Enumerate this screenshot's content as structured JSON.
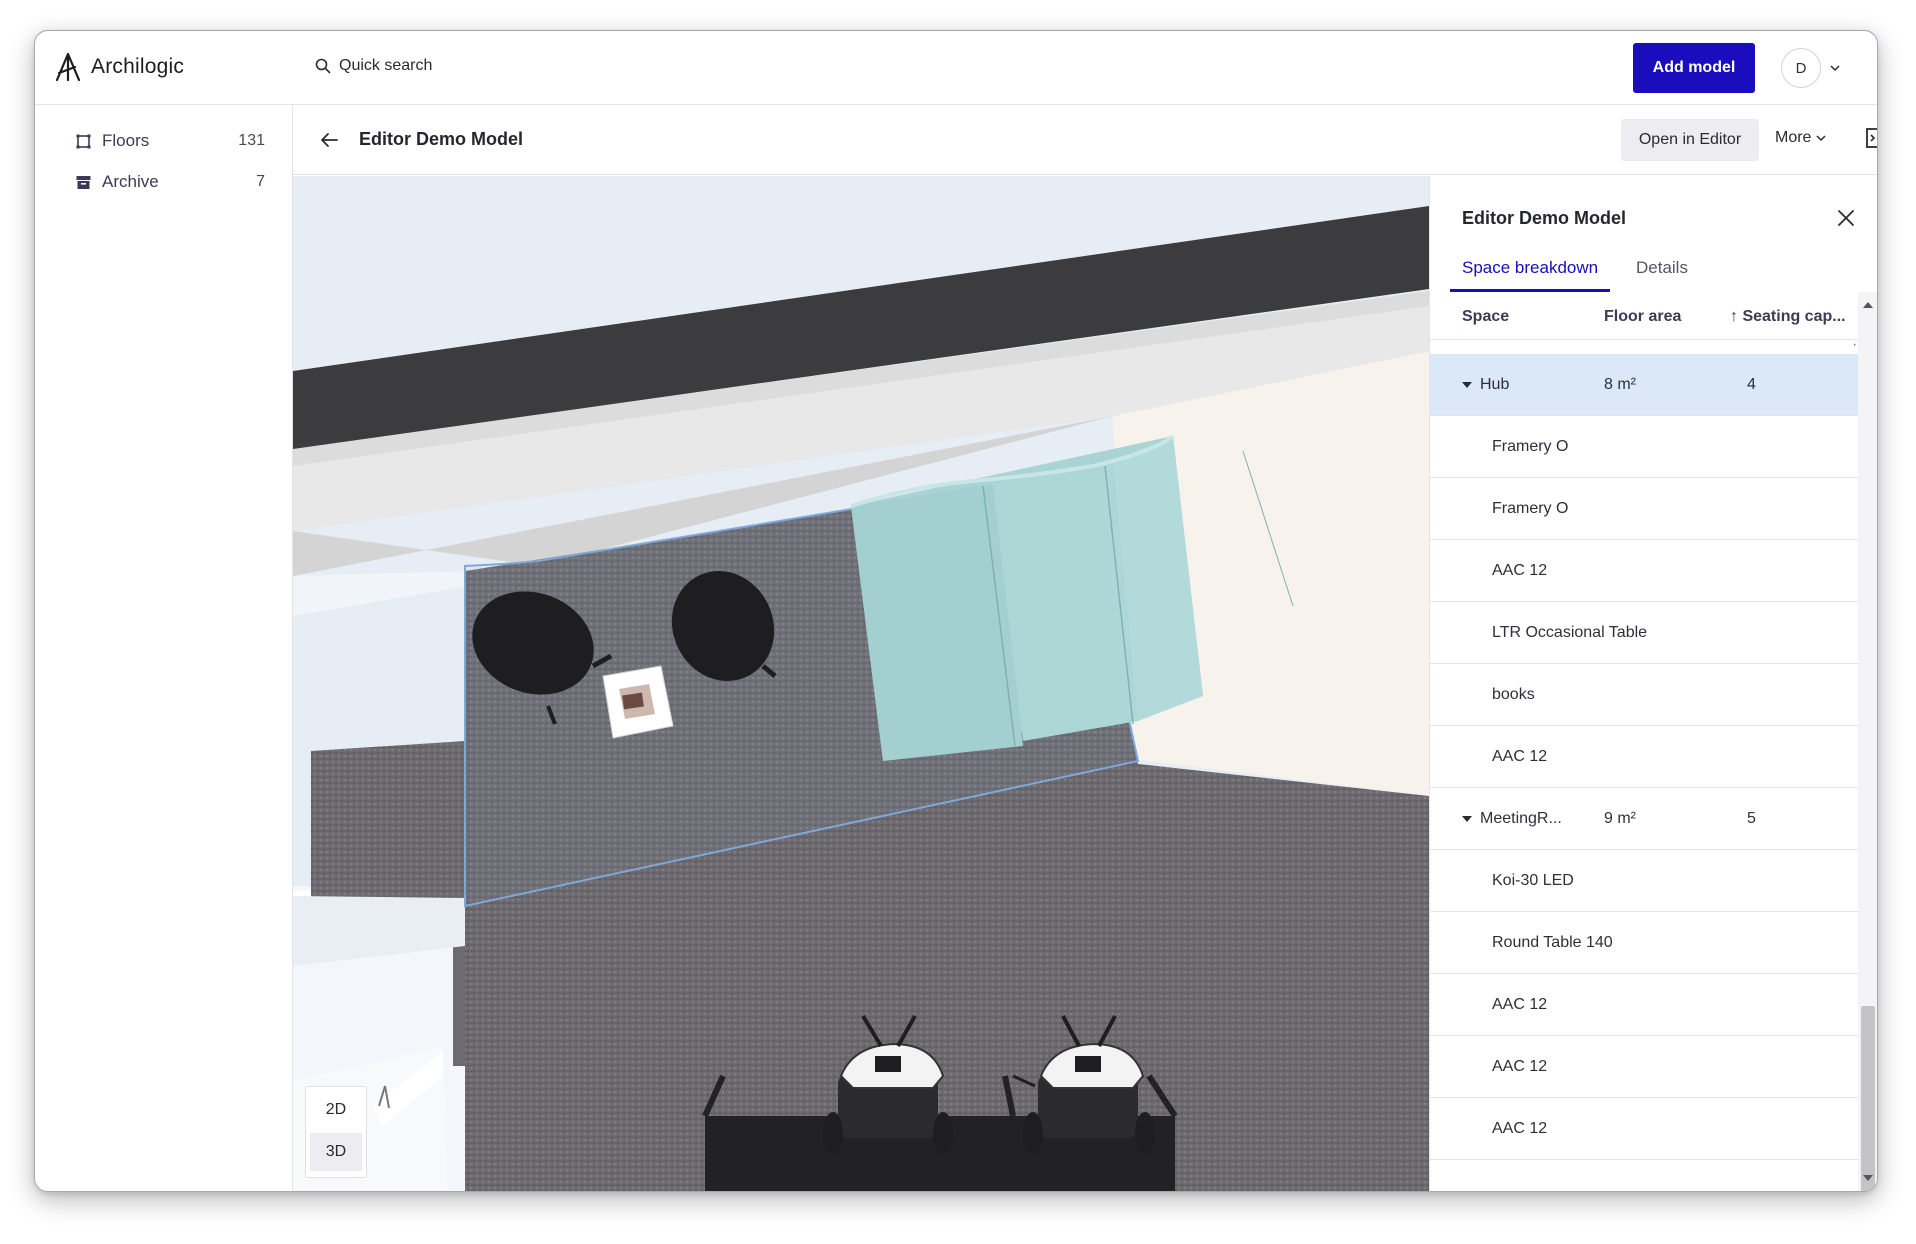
{
  "app": {
    "brand": "Archilogic",
    "search_label": "Quick search",
    "add_model_label": "Add model",
    "user_initial": "D"
  },
  "sidebar": {
    "items": [
      {
        "label": "Floors",
        "count": "131",
        "icon": "floor-plan-icon"
      },
      {
        "label": "Archive",
        "count": "7",
        "icon": "archive-icon"
      }
    ]
  },
  "subheader": {
    "title": "Editor Demo Model",
    "open_editor_label": "Open in Editor",
    "more_label": "More"
  },
  "viewer": {
    "mode_2d": "2D",
    "mode_3d": "3D",
    "active_mode": "3D"
  },
  "panel": {
    "title": "Editor Demo Model",
    "tabs": [
      {
        "label": "Space breakdown",
        "active": true
      },
      {
        "label": "Details",
        "active": false
      }
    ],
    "columns": {
      "space": "Space",
      "floor_area": "Floor area",
      "seating": "↑ Seating cap..."
    },
    "rows": [
      {
        "space": "Hub",
        "area": "8 m²",
        "seating": "4",
        "group": true,
        "selected": true
      },
      {
        "space": "Framery O",
        "area": "",
        "seating": "",
        "group": false
      },
      {
        "space": "Framery O",
        "area": "",
        "seating": "",
        "group": false
      },
      {
        "space": "AAC 12",
        "area": "",
        "seating": "",
        "group": false
      },
      {
        "space": "LTR Occasional Table",
        "area": "",
        "seating": "",
        "group": false
      },
      {
        "space": "books",
        "area": "",
        "seating": "",
        "group": false
      },
      {
        "space": "AAC 12",
        "area": "",
        "seating": "",
        "group": false
      },
      {
        "space": "MeetingR...",
        "area": "9 m²",
        "seating": "5",
        "group": true,
        "selected": false
      },
      {
        "space": "Koi-30 LED",
        "area": "",
        "seating": "",
        "group": false
      },
      {
        "space": "Round Table 140",
        "area": "",
        "seating": "",
        "group": false
      },
      {
        "space": "AAC 12",
        "area": "",
        "seating": "",
        "group": false
      },
      {
        "space": "AAC 12",
        "area": "",
        "seating": "",
        "group": false
      },
      {
        "space": "AAC 12",
        "area": "",
        "seating": "",
        "group": false
      }
    ]
  },
  "colors": {
    "accent": "#1a0dbd",
    "selected_row": "#dbe8f8",
    "carpet": "#6d6b70",
    "booth": "#a9d3d4"
  }
}
